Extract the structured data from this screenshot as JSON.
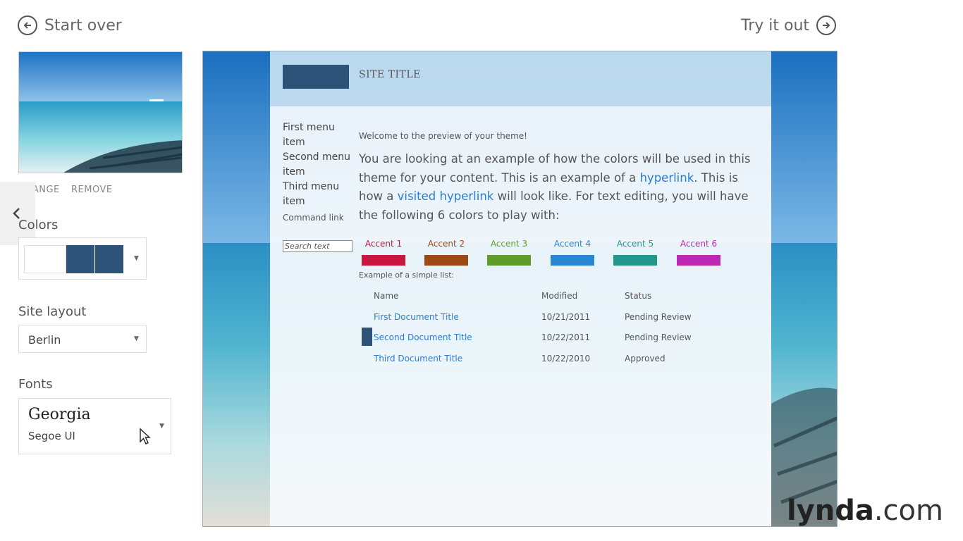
{
  "nav": {
    "back_label": "Start over",
    "try_label": "Try it out"
  },
  "image_actions": {
    "change": "CHANGE",
    "remove": "REMOVE"
  },
  "colors": {
    "label": "Colors",
    "swatches": [
      "#ffffff",
      "#2d5378",
      "#2d5378"
    ]
  },
  "layout": {
    "label": "Site layout",
    "value": "Berlin"
  },
  "fonts": {
    "label": "Fonts",
    "heading": "Georgia",
    "body": "Segoe UI"
  },
  "preview": {
    "site_title": "SITE TITLE",
    "menu": [
      "First menu item",
      "Second menu item",
      "Third menu item"
    ],
    "command_link": "Command link",
    "search_placeholder": "Search text",
    "welcome": "Welcome to the preview of your theme!",
    "para": {
      "t1": "You are looking at an example of how the colors will be used in this theme for your content. This is an example of a ",
      "link": "hyperlink",
      "t2": ". This is how a ",
      "visited": "visited hyperlink",
      "t3": " will look like. For text editing, you will have the following 6 colors to play with:"
    },
    "accents": [
      {
        "label": "Accent 1",
        "color": "#c8163e"
      },
      {
        "label": "Accent 2",
        "color": "#9b4a16"
      },
      {
        "label": "Accent 3",
        "color": "#5f9d2a"
      },
      {
        "label": "Accent 4",
        "color": "#2b86d1"
      },
      {
        "label": "Accent 5",
        "color": "#23978a"
      },
      {
        "label": "Accent 6",
        "color": "#bd27b4"
      }
    ],
    "list_caption": "Example of a simple list:",
    "columns": [
      "Name",
      "Modified",
      "Status"
    ],
    "rows": [
      {
        "name": "First Document Title",
        "modified": "10/21/2011",
        "status": "Pending Review"
      },
      {
        "name": "Second Document Title",
        "modified": "10/22/2011",
        "status": "Pending Review"
      },
      {
        "name": "Third Document Title",
        "modified": "10/22/2010",
        "status": "Approved"
      }
    ]
  },
  "watermark": {
    "brand": "lynda",
    "suffix": ".com"
  }
}
